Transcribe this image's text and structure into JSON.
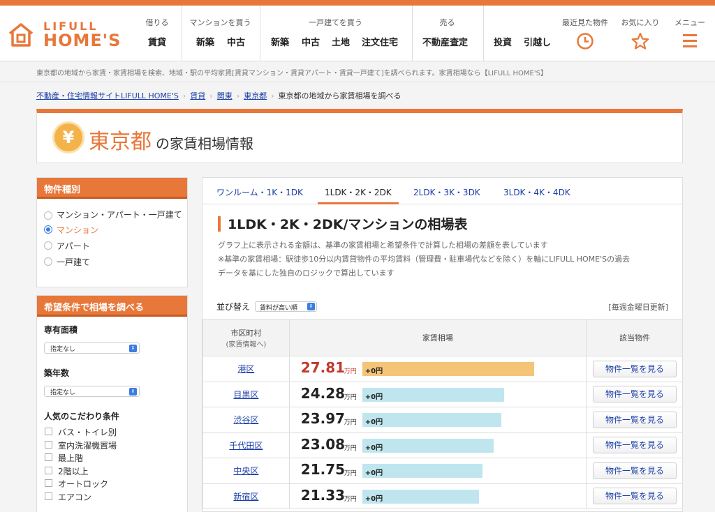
{
  "header": {
    "logo_line1": "LIFULL",
    "logo_line2": "HOME'S",
    "nav_groups": [
      {
        "caption": "借りる",
        "items": [
          "賃貸"
        ]
      },
      {
        "caption": "マンションを買う",
        "items": [
          "新築",
          "中古"
        ]
      },
      {
        "caption": "一戸建てを買う",
        "items": [
          "新築",
          "中古",
          "土地",
          "注文住宅"
        ]
      },
      {
        "caption": "売る",
        "items": [
          "不動産査定"
        ]
      },
      {
        "caption": "",
        "items": [
          "投資",
          "引越し"
        ]
      }
    ],
    "recent_label": "最近見た物件",
    "favorites_label": "お気に入り",
    "menu_label": "メニュー",
    "icons": [
      "clock-icon",
      "star-icon",
      "hamburger-icon"
    ],
    "accent_color": "#e8773a"
  },
  "description": "東京都の地域から家賃・家賃相場を検索、地域・駅の平均家賃[賃貸マンション・賃貸アパート・賃貸一戸建て]を調べられます。家賃相場なら【LIFULL HOME'S】",
  "breadcrumb": {
    "links": [
      "不動産・住宅情報サイトLIFULL HOME'S",
      "賃貸",
      "関東",
      "東京都"
    ],
    "current": "東京都の地域から家賃相場を調べる"
  },
  "title": {
    "prefecture": "東京都",
    "rest": "の家賃相場情報",
    "icon_glyph": "¥"
  },
  "sidebar": {
    "property_type": {
      "heading": "物件種別",
      "options": [
        "マンション・アパート・一戸建て",
        "マンション",
        "アパート",
        "一戸建て"
      ],
      "selected": "マンション"
    },
    "conditions": {
      "heading": "希望条件で相場を調べる",
      "area_label": "専有面積",
      "area_value": "指定なし",
      "age_label": "築年数",
      "age_value": "指定なし",
      "features_label": "人気のこだわり条件",
      "features": [
        "バス・トイレ別",
        "室内洗濯機置場",
        "最上階",
        "2階以上",
        "オートロック",
        "エアコン"
      ]
    }
  },
  "main": {
    "tabs": [
      "ワンルーム・1K・1DK",
      "1LDK・2K・2DK",
      "2LDK・3K・3DK",
      "3LDK・4K・4DK"
    ],
    "active_tab": "1LDK・2K・2DK",
    "heading": "1LDK・2K・2DK/マンションの相場表",
    "note1": "グラフ上に表示される金額は、基準の家賃相場と希望条件で計算した相場の差額を表しています",
    "note2": "※基準の家賃相場：駅徒歩10分以内賃貸物件の平均賃料（管理費・駐車場代などを除く）を軸にLIFULL HOME'Sの過去",
    "note3": "データを基にした独自のロジックで算出しています",
    "sort_label": "並び替え",
    "sort_value": "賃料が高い順",
    "update_note": "[毎週金曜日更新]",
    "columns": {
      "ward": "市区町村",
      "ward_sub": "(家賃情報へ)",
      "rent": "家賃相場",
      "listing": "該当物件"
    },
    "unit": "万円",
    "button_label": "物件一覧を見る",
    "rows": [
      {
        "ward": "港区",
        "rent": "27.81",
        "rent_value": 27.81,
        "diff": "+0円"
      },
      {
        "ward": "目黒区",
        "rent": "24.28",
        "rent_value": 24.28,
        "diff": "+0円"
      },
      {
        "ward": "渋谷区",
        "rent": "23.97",
        "rent_value": 23.97,
        "diff": "+0円"
      },
      {
        "ward": "千代田区",
        "rent": "23.08",
        "rent_value": 23.08,
        "diff": "+0円"
      },
      {
        "ward": "中央区",
        "rent": "21.75",
        "rent_value": 21.75,
        "diff": "+0円"
      },
      {
        "ward": "新宿区",
        "rent": "21.33",
        "rent_value": 21.33,
        "diff": "+0円"
      }
    ],
    "bar_colors": {
      "top": "#f4c577",
      "normal": "#bfe6ef"
    }
  }
}
